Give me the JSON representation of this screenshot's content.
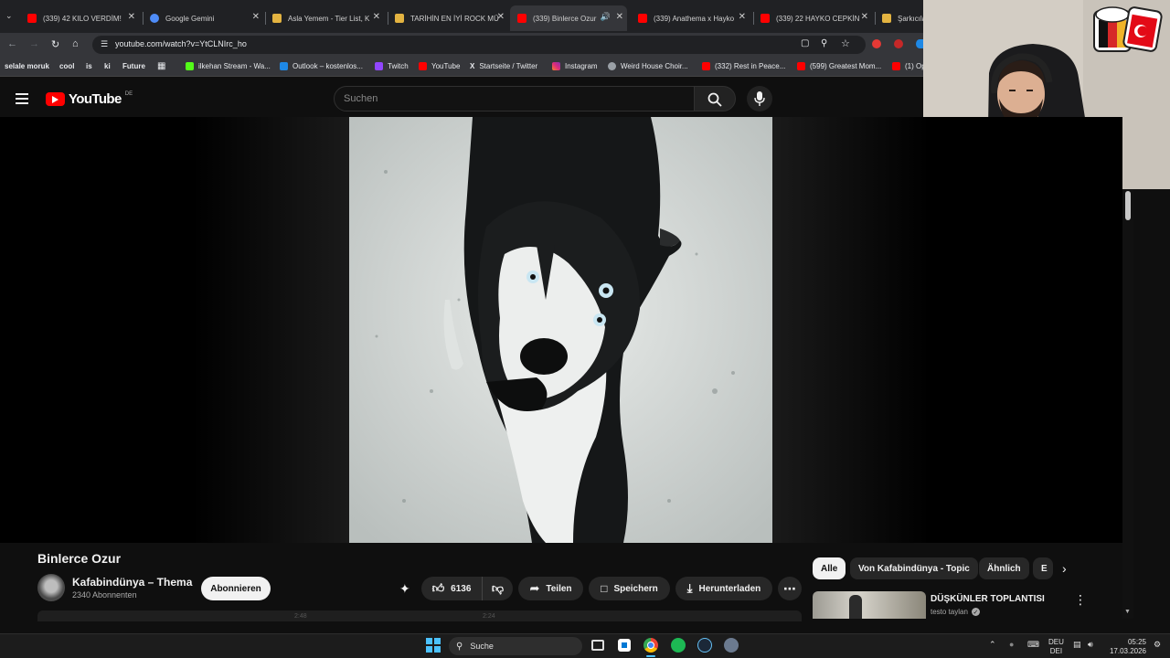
{
  "browser": {
    "tabs": [
      {
        "title": "(339) 42 KILO VERDİM!",
        "color": "#ff0000"
      },
      {
        "title": "Google Gemini",
        "color": "#4e8cf7"
      },
      {
        "title": "Asla Yemem - Tier List, K",
        "color": "#e3b341"
      },
      {
        "title": "TARİHİN EN İYİ ROCK MÜ",
        "color": "#e3b341"
      },
      {
        "title": "(339) Binlerce Ozur",
        "color": "#ff0000",
        "active": true
      },
      {
        "title": "(339) Anathema x Hayko",
        "color": "#ff0000"
      },
      {
        "title": "(339) 22 HAYKO CEPKİN",
        "color": "#ff0000"
      },
      {
        "title": "Şarkıcıla",
        "color": "#e3b341"
      }
    ],
    "url": "youtube.com/watch?v=YtCLNIrc_ho",
    "bookmarks": [
      "selale moruk",
      "cool",
      "is",
      "ki",
      "Future",
      "ilkehan Stream - Wa...",
      "Outlook – kostenlos...",
      "Twitch",
      "YouTube",
      "Startseite / Twitter",
      "Instagram",
      "Weird House Choir...",
      "(332) Rest in Peace...",
      "(599) Greatest Mom...",
      "(1) Op"
    ]
  },
  "youtube": {
    "logo_text": "YouTube",
    "region": "DE",
    "search_placeholder": "Suchen",
    "video_title": "Binlerce Ozur",
    "channel_name": "Kafabindünya – Thema",
    "subscribers": "2340 Abonnenten",
    "subscribe_label": "Abonnieren",
    "likes": "6136",
    "share_label": "Teilen",
    "save_label": "Speichern",
    "download_label": "Herunterladen",
    "chips": [
      "Alle",
      "Von Kafabindünya - Topic",
      "Ähnlich",
      "E"
    ],
    "rec_title": "DÜŞKÜNLER TOPLANTISI",
    "rec_channel": "testo taylan",
    "time_marks": [
      "2:48",
      "2:24"
    ]
  },
  "taskbar": {
    "search_label": "Suche",
    "lang_top": "DEU",
    "lang_bottom": "DEI",
    "time": "05:25",
    "date": "17.03.2026"
  },
  "colors": {
    "yt_red": "#ff0000",
    "accent_blue": "#3ea6ff"
  }
}
